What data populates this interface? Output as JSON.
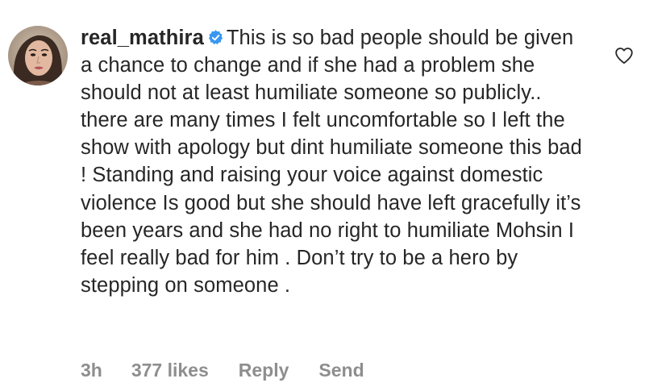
{
  "comment": {
    "username": "real_mathira",
    "verified": true,
    "text": "This is so bad people should be given a chance to change and if she had a problem she should not at least humiliate someone so publicly.. there are many times I felt uncomfortable so I left the show with apology but dint humiliate someone this bad ! Standing and raising your voice against domestic violence Is good but she should have left gracefully it’s been years and she had no right to humiliate Mohsin I feel really bad for him . Don’t try to be a hero by stepping on someone .",
    "avatar_icon": "profile-photo",
    "like_icon": "heart-outline-icon"
  },
  "meta": {
    "time": "3h",
    "likes": "377 likes",
    "reply_label": "Reply",
    "send_label": "Send"
  },
  "colors": {
    "text": "#262626",
    "meta": "#8e8e8e",
    "verified_badge": "#3897f0",
    "background": "#ffffff"
  }
}
